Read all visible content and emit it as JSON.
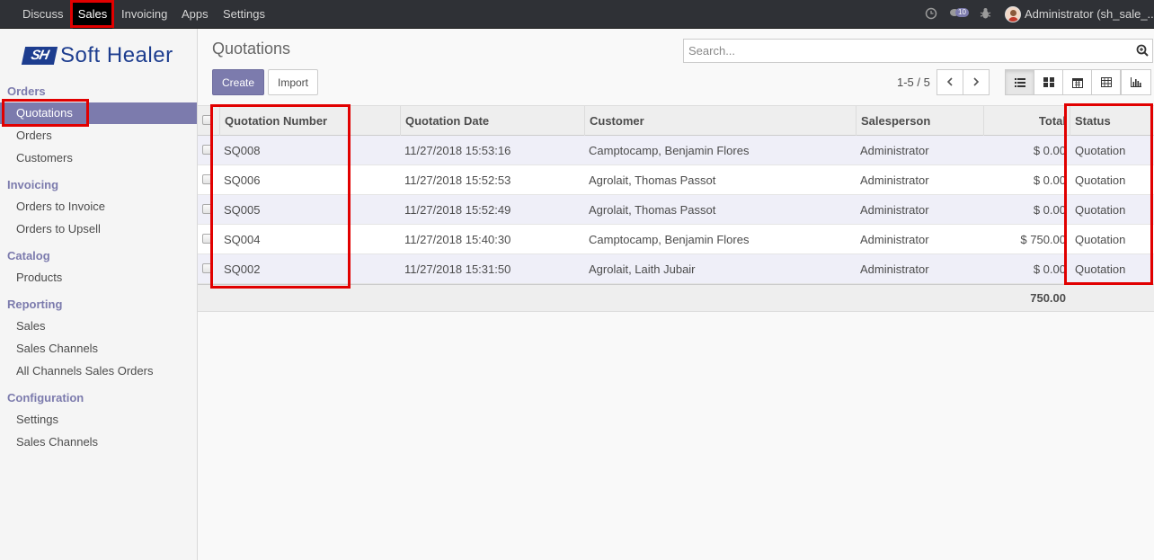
{
  "topbar": {
    "menus": [
      "Discuss",
      "Sales",
      "Invoicing",
      "Apps",
      "Settings"
    ],
    "active_menu": "Sales",
    "message_count": "10",
    "user": "Administrator (sh_sale_..."
  },
  "brand": {
    "logo_mark": "SH",
    "logo_text": "Soft Healer"
  },
  "sidebar": {
    "sections": [
      {
        "title": "Orders",
        "items": [
          "Quotations",
          "Orders",
          "Customers"
        ]
      },
      {
        "title": "Invoicing",
        "items": [
          "Orders to Invoice",
          "Orders to Upsell"
        ]
      },
      {
        "title": "Catalog",
        "items": [
          "Products"
        ]
      },
      {
        "title": "Reporting",
        "items": [
          "Sales",
          "Sales Channels",
          "All Channels Sales Orders"
        ]
      },
      {
        "title": "Configuration",
        "items": [
          "Settings",
          "Sales Channels"
        ]
      }
    ],
    "active_item": "Quotations"
  },
  "control": {
    "title": "Quotations",
    "search_placeholder": "Search...",
    "create_label": "Create",
    "import_label": "Import",
    "pager": "1-5 / 5"
  },
  "table": {
    "columns": [
      "Quotation Number",
      "Quotation Date",
      "Customer",
      "Salesperson",
      "Total",
      "Status"
    ],
    "rows": [
      {
        "number": "SQ008",
        "date": "11/27/2018 15:53:16",
        "customer": "Camptocamp, Benjamin Flores",
        "salesperson": "Administrator",
        "total": "$ 0.00",
        "status": "Quotation"
      },
      {
        "number": "SQ006",
        "date": "11/27/2018 15:52:53",
        "customer": "Agrolait, Thomas Passot",
        "salesperson": "Administrator",
        "total": "$ 0.00",
        "status": "Quotation"
      },
      {
        "number": "SQ005",
        "date": "11/27/2018 15:52:49",
        "customer": "Agrolait, Thomas Passot",
        "salesperson": "Administrator",
        "total": "$ 0.00",
        "status": "Quotation"
      },
      {
        "number": "SQ004",
        "date": "11/27/2018 15:40:30",
        "customer": "Camptocamp, Benjamin Flores",
        "salesperson": "Administrator",
        "total": "$ 750.00",
        "status": "Quotation"
      },
      {
        "number": "SQ002",
        "date": "11/27/2018 15:31:50",
        "customer": "Agrolait, Laith Jubair",
        "salesperson": "Administrator",
        "total": "$ 0.00",
        "status": "Quotation"
      }
    ],
    "footer_total": "750.00"
  },
  "colors": {
    "accent": "#7c7bad",
    "navbar": "#2f3136",
    "highlight": "#e10000"
  }
}
